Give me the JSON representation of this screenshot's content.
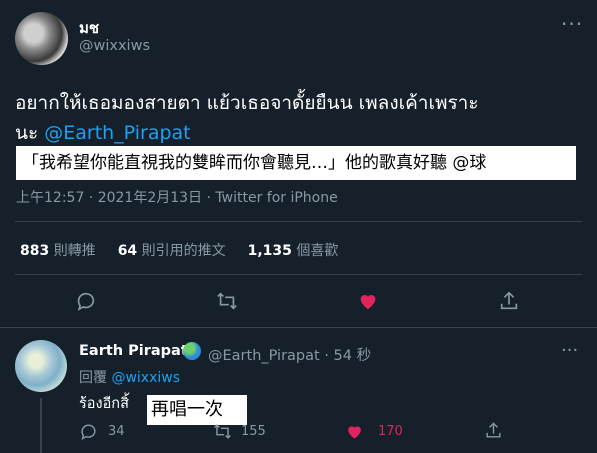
{
  "tweet": {
    "author_name": "มช",
    "author_handle": "@wixxiws",
    "text_line1": "อยากให้เธอมองสายตา แย้วเธอจาดั้ยยืนน เพลงเค้าเพราะ",
    "text_line2_prefix": "นะ ",
    "mention": "@Earth_Pirapat",
    "overlay_text": "「我希望你能直視我的雙眸而你會聽見…」他的歌真好聽 @球",
    "meta": "上午12:57 · 2021年2月13日 · Twitter for iPhone",
    "stats": [
      {
        "count": "883",
        "label": "則轉推"
      },
      {
        "count": "64",
        "label": "則引用的推文"
      },
      {
        "count": "1,135",
        "label": "個喜歡"
      }
    ],
    "liked": true
  },
  "reply": {
    "author_name": "Earth Pirapat",
    "author_handle": "@Earth_Pirapat",
    "time": "54 秒",
    "replying_label": "回覆",
    "replying_mention": "@wixxiws",
    "text": "ร้องอีกสิ้",
    "overlay_text": "再唱一次",
    "reply_count": "34",
    "retweet_count": "155",
    "like_count": "170"
  },
  "colors": {
    "background": "#15202b",
    "secondary_text": "#8899a6",
    "accent": "#1da1f2",
    "like": "#e0245e"
  },
  "icons": [
    "more-icon",
    "reply-icon",
    "retweet-icon",
    "like-icon",
    "share-icon",
    "globe-icon"
  ]
}
